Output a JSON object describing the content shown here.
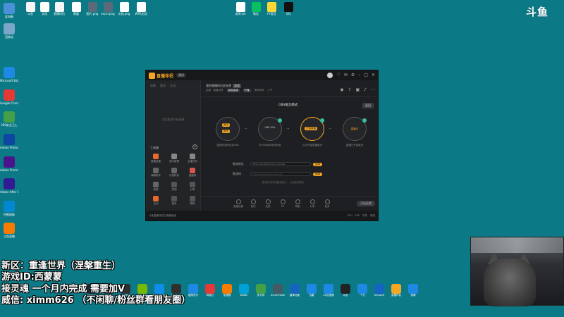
{
  "desktop": {
    "left_icons": [
      {
        "label": "此电脑",
        "color": "#4a90d9"
      },
      {
        "label": "回收站",
        "color": "#7aa7c7"
      },
      {
        "label": "Microsoft Edge",
        "color": "#1e88e5"
      },
      {
        "label": "Google Chrome",
        "color": "#e53935"
      },
      {
        "label": "360安全卫士",
        "color": "#43a047"
      },
      {
        "label": "Adobe Photoshop",
        "color": "#0d47a1"
      },
      {
        "label": "Adobe Premiere",
        "color": "#4a148c"
      },
      {
        "label": "Adobe After Effects",
        "color": "#311b92"
      },
      {
        "label": "控制面板",
        "color": "#0288d1"
      },
      {
        "label": "斗鱼直播",
        "color": "#f57c00"
      }
    ],
    "top_icons": [
      {
        "label": "斗鱼",
        "color": "#f5f5f5"
      },
      {
        "label": "文档",
        "color": "#ffffff"
      },
      {
        "label": "直播伴侣",
        "color": "#f5f5f5"
      },
      {
        "label": "数据",
        "color": "#ffffff"
      },
      {
        "label": "图片.png",
        "color": "#5a6a7a"
      },
      {
        "label": "excel.png",
        "color": "#5a6a7a"
      },
      {
        "label": "文档.png",
        "color": "#ffffff"
      },
      {
        "label": "WPS文档",
        "color": "#ffffff"
      }
    ],
    "top_center_icons": [
      {
        "label": "说明.txt",
        "color": "#ffffff"
      },
      {
        "label": "微信",
        "color": "#07c160"
      },
      {
        "label": "YY语音",
        "color": "#fdd835"
      },
      {
        "label": "QQ",
        "color": "#111111"
      }
    ]
  },
  "watermark": "斗鱼",
  "app": {
    "name": "直播伴侣",
    "version": "测试",
    "left_tabs": [
      "场景",
      "素材",
      "互动"
    ],
    "empty_text": "添加素材开始直播",
    "tools_title": "工具箱",
    "tools": [
      {
        "label": "直播设置",
        "color": "#e8692c"
      },
      {
        "label": "观众管理",
        "color": "#888888"
      },
      {
        "label": "主播任务",
        "color": "#888888"
      },
      {
        "label": "弹幕助手",
        "color": "#666666"
      },
      {
        "label": "礼物特效",
        "color": "#666666"
      },
      {
        "label": "直播间",
        "color": "#d9534f"
      },
      {
        "label": "美颜",
        "color": "#666666"
      },
      {
        "label": "录制",
        "color": "#555555"
      },
      {
        "label": "分享",
        "color": "#555555"
      },
      {
        "label": "活动",
        "color": "#e8692c"
      },
      {
        "label": "更多",
        "color": "#555555"
      },
      {
        "label": "帮助",
        "color": "#555555"
      }
    ],
    "room_title": "我的直播间分区标签",
    "room_tag": "游戏",
    "room_meta": [
      "区服：重逢世界",
      "画质高清",
      "开播",
      "房间号码",
      "人气"
    ],
    "steps_title": "OBS推流模式",
    "back_label": "返回",
    "steps": [
      {
        "btn1": "推流",
        "btn2": "推流",
        "caption": "复制推流地址到OBS"
      },
      {
        "inner": "OBS URL",
        "caption": "在OBS填写推流地址"
      },
      {
        "btn1": "开始直播",
        "caption": "点击开始直播推流"
      },
      {
        "inner": "直播中",
        "caption": "直播已开始推流"
      }
    ],
    "fields": [
      {
        "label": "推流地址",
        "value": "rtmp://sendtc3.douyu.com/live",
        "btn": "复制"
      },
      {
        "label": "推流码",
        "value": "••••••••••••••••••••••••",
        "btn": "复制"
      }
    ],
    "field_note": "推流码请勿泄露给他人，以免造成损失",
    "bottom_items": [
      "直播设置",
      "音效",
      "连麦",
      "PK",
      "录制",
      "分享",
      "更多"
    ],
    "live_button": "开始直播",
    "status_text": "斗鱼直播伴侣已准备就绪",
    "status_right": [
      "CPU",
      "FPS",
      "内存",
      "网络"
    ]
  },
  "overlay": {
    "line1": "新区：重逢世界（涅槃重生）",
    "line2": "游戏ID:西蒙蒙",
    "line3": "接灵魂 一个月内完成 需要加V",
    "line4": "威信: ximm626 （不闲聊/粉丝群看朋友圈）"
  },
  "taskbar": [
    {
      "label": "Steam",
      "color": "#1b2838"
    },
    {
      "label": "EPIC",
      "color": "#2a2a2a"
    },
    {
      "label": "OBS",
      "color": "#302e31"
    },
    {
      "label": "NVIDIA",
      "color": "#76b900"
    },
    {
      "label": "TeamViewer",
      "color": "#0e8ee9"
    },
    {
      "label": "Logitech",
      "color": "#2f2f2f"
    },
    {
      "label": "酷狗音乐",
      "color": "#1e88e5"
    },
    {
      "label": "网易云",
      "color": "#e53935"
    },
    {
      "label": "加速器",
      "color": "#f57c00"
    },
    {
      "label": "BiliBili",
      "color": "#00a1d6"
    },
    {
      "label": "鲁大师",
      "color": "#43a047"
    },
    {
      "label": "ScreenToGif",
      "color": "#455a64"
    },
    {
      "label": "雷神加速",
      "color": "#1565c0"
    },
    {
      "label": "迅雷",
      "color": "#1e88e5"
    },
    {
      "label": "UU加速器",
      "color": "#1e88e5"
    },
    {
      "label": "斗鱼",
      "color": "#222222"
    },
    {
      "label": "飞书",
      "color": "#1e88e5"
    },
    {
      "label": "Kingsoft",
      "color": "#1565c0"
    },
    {
      "label": "直播伴侣",
      "color": "#f5a623"
    },
    {
      "label": "剪辑",
      "color": "#1e88e5"
    }
  ]
}
